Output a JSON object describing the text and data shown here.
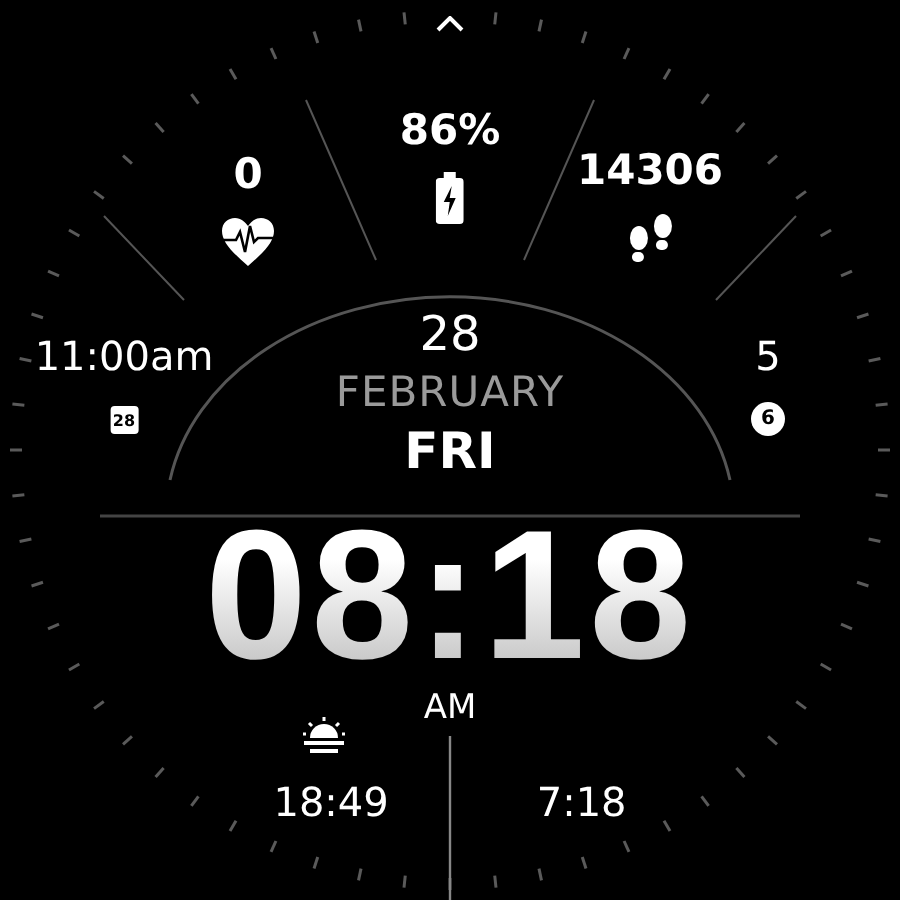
{
  "complications": [
    {
      "kind": "heart",
      "value": "0"
    },
    {
      "kind": "battery",
      "value": "86%"
    },
    {
      "kind": "steps",
      "value": "14306"
    },
    {
      "kind": "calendar",
      "value": "11:00am",
      "badge": "28"
    },
    {
      "kind": "notifications",
      "value": "5",
      "badge": "6"
    }
  ],
  "date": {
    "day": "28",
    "month": "FEBRUARY",
    "weekday": "FRI"
  },
  "time": "08:18",
  "period": "AM",
  "sun": [
    {
      "kind": "sunset",
      "value": "18:49"
    },
    {
      "kind": "sunrise",
      "value": "7:18"
    }
  ]
}
